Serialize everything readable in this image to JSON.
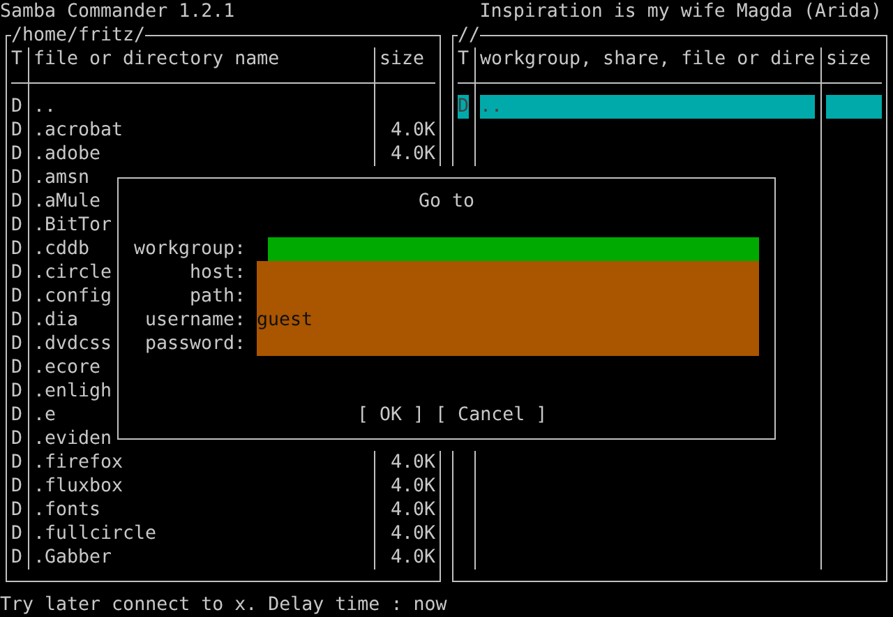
{
  "app_title": "Samba Commander 1.2.1",
  "tagline": "Inspiration is my wife Magda (Arida)",
  "panels": [
    {
      "path": "/home/fritz/",
      "columns": [
        "T",
        "file or directory name",
        "size"
      ],
      "rows": [
        {
          "type": "D",
          "name": "..",
          "selected": false
        },
        {
          "type": "D",
          "name": ".acrobat",
          "size": "4.0K",
          "selected": false
        },
        {
          "type": "D",
          "name": ".adobe",
          "size": "4.0K",
          "selected": false
        },
        {
          "type": "D",
          "name": ".amsn",
          "selected": false
        },
        {
          "type": "D",
          "name": ".aMule",
          "selected": false
        },
        {
          "type": "D",
          "name": ".BitTor",
          "selected": false
        },
        {
          "type": "D",
          "name": ".cddb",
          "selected": false
        },
        {
          "type": "D",
          "name": ".circle",
          "selected": false
        },
        {
          "type": "D",
          "name": ".config",
          "selected": false
        },
        {
          "type": "D",
          "name": ".dia",
          "selected": false
        },
        {
          "type": "D",
          "name": ".dvdcss",
          "selected": false
        },
        {
          "type": "D",
          "name": ".ecore",
          "selected": false
        },
        {
          "type": "D",
          "name": ".enligh",
          "selected": false
        },
        {
          "type": "D",
          "name": ".e",
          "selected": false
        },
        {
          "type": "D",
          "name": ".eviden",
          "selected": false
        },
        {
          "type": "D",
          "name": ".firefox",
          "size": "4.0K",
          "selected": false
        },
        {
          "type": "D",
          "name": ".fluxbox",
          "size": "4.0K",
          "selected": false
        },
        {
          "type": "D",
          "name": ".fonts",
          "size": "4.0K",
          "selected": false
        },
        {
          "type": "D",
          "name": ".fullcircle",
          "size": "4.0K",
          "selected": false
        },
        {
          "type": "D",
          "name": ".Gabber",
          "size": "4.0K",
          "selected": false
        }
      ]
    },
    {
      "path": "//",
      "columns": [
        "T",
        "workgroup, share, file or dire",
        "size"
      ],
      "rows": [
        {
          "type": "D",
          "name": "..",
          "selected": true
        }
      ]
    }
  ],
  "dialog": {
    "title": "Go to",
    "fields": [
      {
        "label": "workgroup:",
        "focused": true
      },
      {
        "label": "host:",
        "focused": false
      },
      {
        "label": "path:",
        "focused": false
      },
      {
        "label": "username:",
        "value": "guest",
        "focused": false
      },
      {
        "label": "password:",
        "focused": false
      }
    ],
    "buttons": [
      "[ OK ]",
      "[ Cancel ]"
    ]
  },
  "status": "Try later connect to x. Delay time : now"
}
